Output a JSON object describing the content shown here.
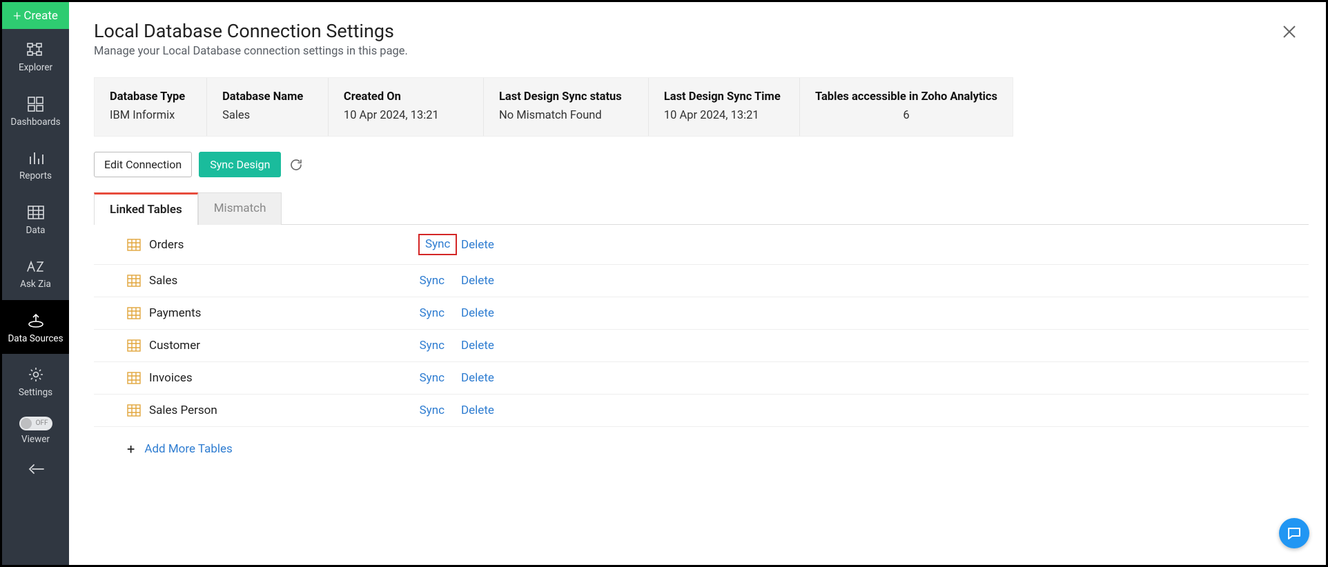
{
  "sidebar": {
    "create_label": "Create",
    "items": [
      {
        "label": "Explorer"
      },
      {
        "label": "Dashboards"
      },
      {
        "label": "Reports"
      },
      {
        "label": "Data"
      },
      {
        "label": "Ask Zia"
      },
      {
        "label": "Data Sources"
      },
      {
        "label": "Settings"
      }
    ],
    "toggle_text": "OFF",
    "viewer_label": "Viewer"
  },
  "page": {
    "title": "Local Database Connection Settings",
    "subtitle": "Manage your Local Database connection settings in this page."
  },
  "info": {
    "db_type_label": "Database Type",
    "db_type_value": "IBM Informix",
    "db_name_label": "Database Name",
    "db_name_value": "Sales",
    "created_label": "Created On",
    "created_value": "10 Apr 2024, 13:21",
    "sync_status_label": "Last Design Sync status",
    "sync_status_value": "No Mismatch Found",
    "sync_time_label": "Last Design Sync Time",
    "sync_time_value": "10 Apr 2024, 13:21",
    "accessible_label": "Tables accessible in Zoho Analytics",
    "accessible_value": "6"
  },
  "buttons": {
    "edit_connection": "Edit Connection",
    "sync_design": "Sync Design"
  },
  "tabs": {
    "linked": "Linked Tables",
    "mismatch": "Mismatch"
  },
  "table_actions": {
    "sync": "Sync",
    "delete": "Delete"
  },
  "tables": [
    {
      "name": "Orders"
    },
    {
      "name": "Sales"
    },
    {
      "name": "Payments"
    },
    {
      "name": "Customer"
    },
    {
      "name": "Invoices"
    },
    {
      "name": "Sales Person"
    }
  ],
  "add_more_label": "Add More Tables"
}
